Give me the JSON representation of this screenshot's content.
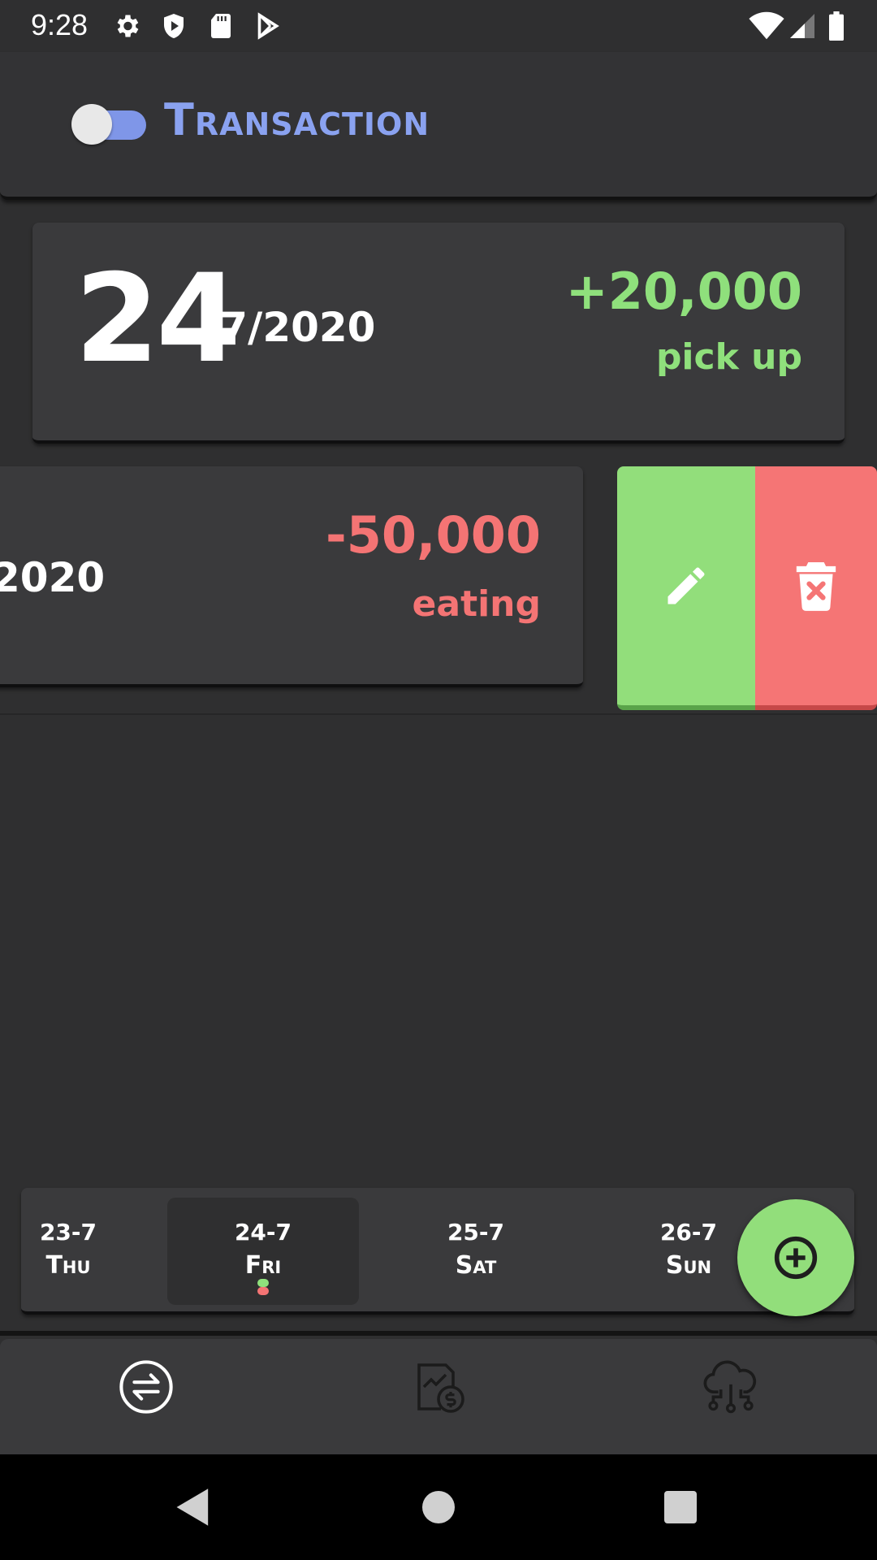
{
  "status_bar": {
    "time": "9:28",
    "left_icons": [
      "settings-icon",
      "shield-play-icon",
      "sd-card-icon",
      "play-store-icon"
    ],
    "right_icons": [
      "wifi-icon",
      "signal-icon",
      "battery-icon"
    ]
  },
  "header": {
    "title": "Transaction",
    "toggle_on": true,
    "accent_color": "#8aa2f0"
  },
  "transactions": [
    {
      "day": "24",
      "rest_of_date": "/7/2020",
      "amount": "+20,000",
      "note": "pick up",
      "color": "#8fe07c"
    },
    {
      "visible_date": "2020",
      "amount": "-50,000",
      "note": "eating",
      "color": "#f47474",
      "swipe_actions": [
        "edit-icon",
        "delete-icon"
      ]
    }
  ],
  "date_strip": [
    {
      "date": "23-7",
      "weekday": "Thu",
      "selected": false
    },
    {
      "date": "24-7",
      "weekday": "Fri",
      "selected": true,
      "indicators": [
        "#8fe07c",
        "#f47474"
      ]
    },
    {
      "date": "25-7",
      "weekday": "Sat",
      "selected": false
    },
    {
      "date": "26-7",
      "weekday": "Sun",
      "selected": false
    }
  ],
  "fab": {
    "icon": "add-circle-icon",
    "color": "#92de7b"
  },
  "bottom_nav": [
    {
      "icon": "transactions-icon",
      "active": true
    },
    {
      "icon": "report-money-icon",
      "active": false
    },
    {
      "icon": "cloud-network-icon",
      "active": false
    }
  ],
  "system_nav": [
    "back-icon",
    "home-icon",
    "recents-icon"
  ]
}
